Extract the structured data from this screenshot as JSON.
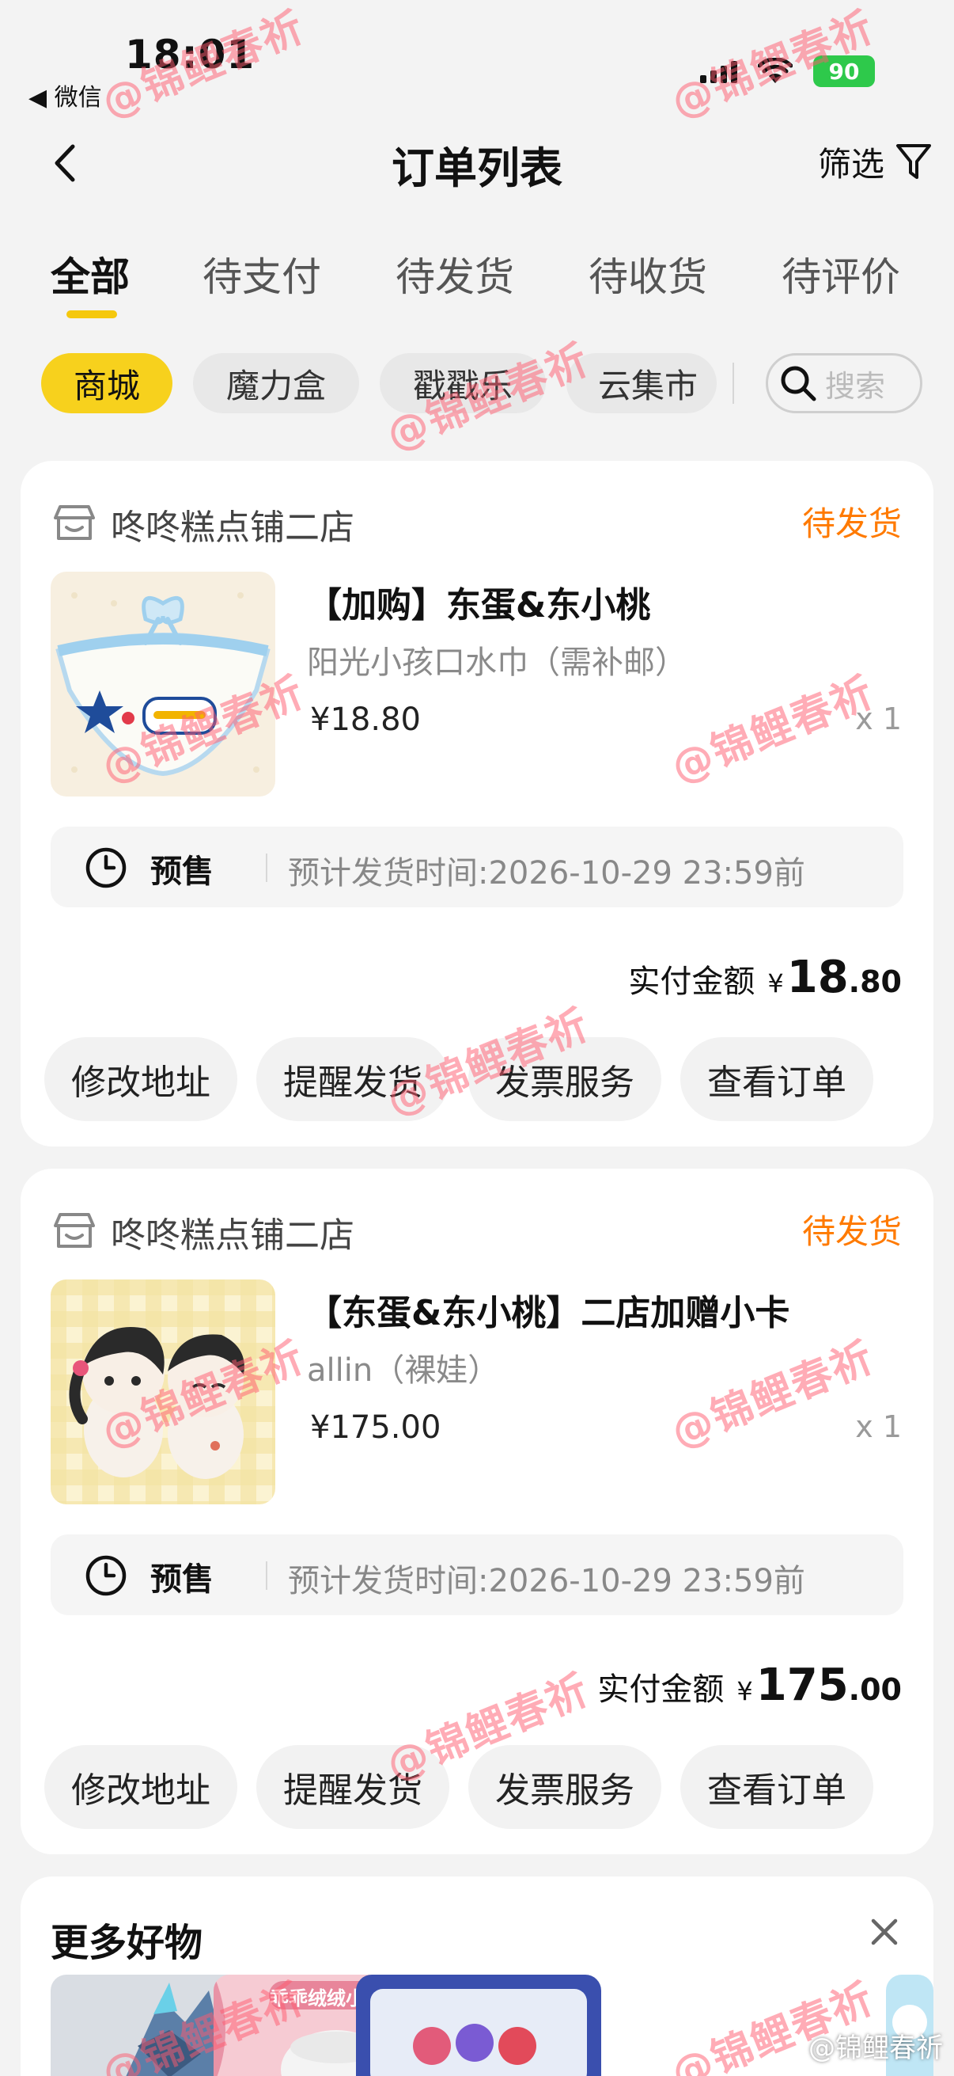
{
  "status_bar": {
    "time": "18:01",
    "back_app": "◀ 微信",
    "battery": "90"
  },
  "nav": {
    "title": "订单列表",
    "filter_label": "筛选"
  },
  "tabs": [
    {
      "label": "全部",
      "active": true
    },
    {
      "label": "待支付"
    },
    {
      "label": "待发货"
    },
    {
      "label": "待收货"
    },
    {
      "label": "待评价"
    }
  ],
  "channels": [
    {
      "label": "商城",
      "active": true
    },
    {
      "label": "魔力盒"
    },
    {
      "label": "戳戳乐"
    },
    {
      "label": "云集市"
    }
  ],
  "search": {
    "placeholder": "搜索"
  },
  "orders": [
    {
      "shop": "咚咚糕点铺二店",
      "status": "待发货",
      "title": "【加购】东蛋&东小桃",
      "variant": "阳光小孩口水巾（需补邮）",
      "price": "¥18.80",
      "qty": "x 1",
      "presale_label": "预售",
      "presale_eta": "预计发货时间:2026-10-29 23:59前",
      "paid_label": "实付金额",
      "paid_currency": "¥",
      "paid_int": "18",
      "paid_dec": ".80",
      "actions": [
        "修改地址",
        "提醒发货",
        "发票服务",
        "查看订单"
      ]
    },
    {
      "shop": "咚咚糕点铺二店",
      "status": "待发货",
      "title": "【东蛋&东小桃】二店加赠小卡",
      "variant": "allin（裸娃）",
      "price": "¥175.00",
      "qty": "x 1",
      "presale_label": "预售",
      "presale_eta": "预计发货时间:2026-10-29 23:59前",
      "paid_label": "实付金额",
      "paid_currency": "¥",
      "paid_int": "175",
      "paid_dec": ".00",
      "actions": [
        "修改地址",
        "提醒发货",
        "发票服务",
        "查看订单"
      ]
    }
  ],
  "more": {
    "title": "更多好物",
    "banner_text": "乖乖绒绒小豆总"
  },
  "watermark": {
    "text": "@锦鲤春祈",
    "corner": "@锦鲤春祈"
  },
  "colors": {
    "accent": "#f7d11d",
    "status": "#ff7a00",
    "battery": "#2ec94b"
  }
}
